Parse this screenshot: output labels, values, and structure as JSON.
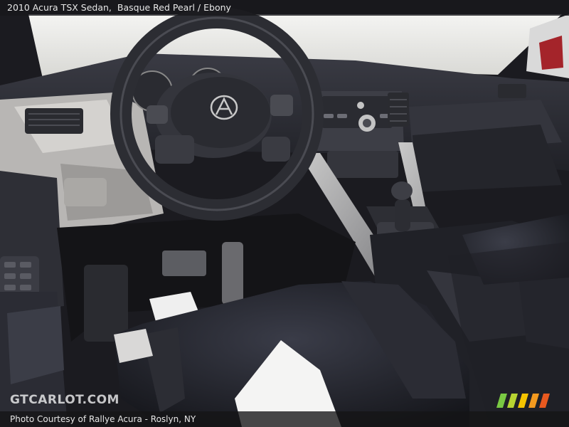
{
  "caption": {
    "vehicle": "2010 Acura TSX Sedan,",
    "color": "Basque Red Pearl / Ebony"
  },
  "watermark": {
    "text": "GTCARLOT.COM"
  },
  "footer": {
    "credit": "Photo Courtesy of Rallye Acura - Roslyn, NY"
  },
  "colors": {
    "stripe_colors": [
      "#7ac943",
      "#b8d432",
      "#f5c400",
      "#f39a1f",
      "#e8591f"
    ]
  }
}
